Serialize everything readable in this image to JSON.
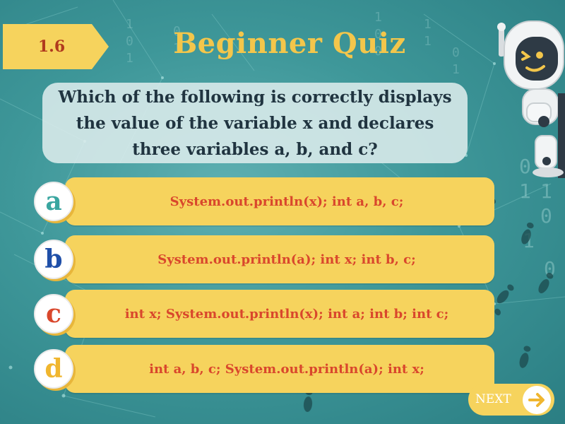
{
  "quiz": {
    "section_number": "1.6",
    "title": "Beginner Quiz",
    "question": "Which of the following is correctly displays the value of the variable x and declares three variables a, b, and c?",
    "options": [
      {
        "letter": "a",
        "text": "System.out.println(x); int a, b, c;",
        "letter_color": "#3aa6a0"
      },
      {
        "letter": "b",
        "text": "System.out.println(a); int x; int b, c;",
        "letter_color": "#1f4fa8"
      },
      {
        "letter": "c",
        "text": "int x; System.out.println(x); int a; int b; int c;",
        "letter_color": "#d9472c"
      },
      {
        "letter": "d",
        "text": "int a, b, c; System.out.println(a); int x;",
        "letter_color": "#f0b62f"
      }
    ],
    "next_label": "NEXT"
  },
  "colors": {
    "background": "#3e9799",
    "title": "#f3c64b",
    "option_fill": "#f6d35d",
    "option_text": "#d9472c",
    "question_text": "#203440"
  },
  "icons": {
    "next": "arrow-right-icon",
    "mascot": "robot-mascot-icon"
  }
}
